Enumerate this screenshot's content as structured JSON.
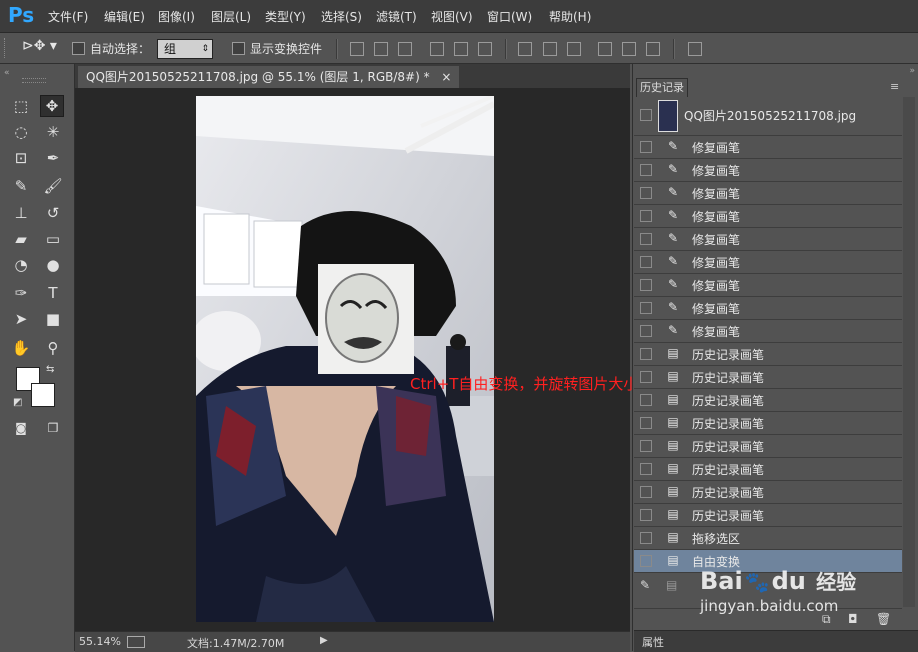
{
  "app": {
    "logo": "Ps"
  },
  "menu": [
    "文件(F)",
    "编辑(E)",
    "图像(I)",
    "图层(L)",
    "类型(Y)",
    "选择(S)",
    "滤镜(T)",
    "视图(V)",
    "窗口(W)",
    "帮助(H)"
  ],
  "options": {
    "auto_select_label": "自动选择：",
    "auto_select_value": "组",
    "show_transform_label": "显示变换控件"
  },
  "document": {
    "tab_title": "QQ图片20150525211708.jpg @ 55.1% (图层 1, RGB/8#) *",
    "tab_close": "×",
    "annotation": "Ctrl+T自由变换，并旋转图片大小",
    "zoom": "55.14%",
    "doc_size": "文档:1.47M/2.70M",
    "status_arrow": "▶"
  },
  "panel": {
    "tab": "历史记录",
    "snapshot": "QQ图片20150525211708.jpg",
    "items": [
      {
        "label": "修复画笔",
        "icon": "healing-brush-icon",
        "glyph": "✎"
      },
      {
        "label": "修复画笔",
        "icon": "healing-brush-icon",
        "glyph": "✎"
      },
      {
        "label": "修复画笔",
        "icon": "healing-brush-icon",
        "glyph": "✎"
      },
      {
        "label": "修复画笔",
        "icon": "healing-brush-icon",
        "glyph": "✎"
      },
      {
        "label": "修复画笔",
        "icon": "healing-brush-icon",
        "glyph": "✎"
      },
      {
        "label": "修复画笔",
        "icon": "healing-brush-icon",
        "glyph": "✎"
      },
      {
        "label": "修复画笔",
        "icon": "healing-brush-icon",
        "glyph": "✎"
      },
      {
        "label": "修复画笔",
        "icon": "healing-brush-icon",
        "glyph": "✎"
      },
      {
        "label": "修复画笔",
        "icon": "healing-brush-icon",
        "glyph": "✎"
      },
      {
        "label": "历史记录画笔",
        "icon": "history-document-icon",
        "glyph": "▤"
      },
      {
        "label": "历史记录画笔",
        "icon": "history-document-icon",
        "glyph": "▤"
      },
      {
        "label": "历史记录画笔",
        "icon": "history-document-icon",
        "glyph": "▤"
      },
      {
        "label": "历史记录画笔",
        "icon": "history-document-icon",
        "glyph": "▤"
      },
      {
        "label": "历史记录画笔",
        "icon": "history-document-icon",
        "glyph": "▤"
      },
      {
        "label": "历史记录画笔",
        "icon": "history-document-icon",
        "glyph": "▤"
      },
      {
        "label": "历史记录画笔",
        "icon": "history-document-icon",
        "glyph": "▤"
      },
      {
        "label": "历史记录画笔",
        "icon": "history-document-icon",
        "glyph": "▤"
      },
      {
        "label": "拖移选区",
        "icon": "history-document-icon",
        "glyph": "▤"
      },
      {
        "label": "自由变换",
        "icon": "history-document-icon",
        "glyph": "▤",
        "selected": true
      }
    ],
    "footer_props": "属性"
  },
  "watermark": {
    "brand": "Bai",
    "brand2": "du",
    "sub": "经验",
    "url": "jingyan.baidu.com"
  },
  "colors": {
    "accent": "#31a8ff",
    "selected_row": "#6f849d",
    "annotation": "#ff2020"
  }
}
